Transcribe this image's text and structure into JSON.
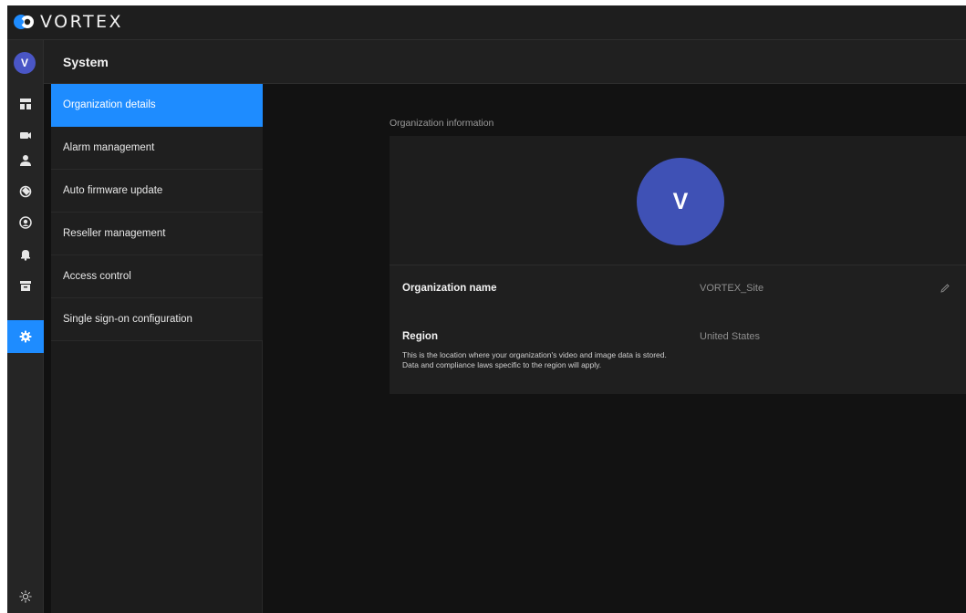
{
  "app": {
    "brand": "VORTEX"
  },
  "rail": {
    "avatar_initial": "V",
    "items": [
      {
        "name": "dashboard-icon"
      },
      {
        "name": "camera-icon"
      },
      {
        "name": "user-icon"
      },
      {
        "name": "tag-icon"
      },
      {
        "name": "account-circle-icon"
      },
      {
        "name": "bell-icon"
      },
      {
        "name": "archive-icon"
      },
      {
        "name": "gear-icon",
        "active": true
      }
    ],
    "bottom_icon": "sun-icon"
  },
  "header": {
    "title": "System"
  },
  "menu": {
    "items": [
      {
        "label": "Organization details",
        "active": true
      },
      {
        "label": "Alarm management"
      },
      {
        "label": "Auto firmware update"
      },
      {
        "label": "Reseller management"
      },
      {
        "label": "Access control"
      },
      {
        "label": "Single sign-on configuration"
      }
    ]
  },
  "content": {
    "section_label": "Organization information",
    "org_avatar_initial": "V",
    "org_name_label": "Organization name",
    "org_name_value": "VORTEX_Site",
    "region_label": "Region",
    "region_value": "United States",
    "region_description": "This is the location where your organization's video and image data is stored. Data and compliance laws specific to the region will apply."
  },
  "colors": {
    "accent": "#1e8cff",
    "avatar": "#3f51b5",
    "background": "#121212"
  }
}
